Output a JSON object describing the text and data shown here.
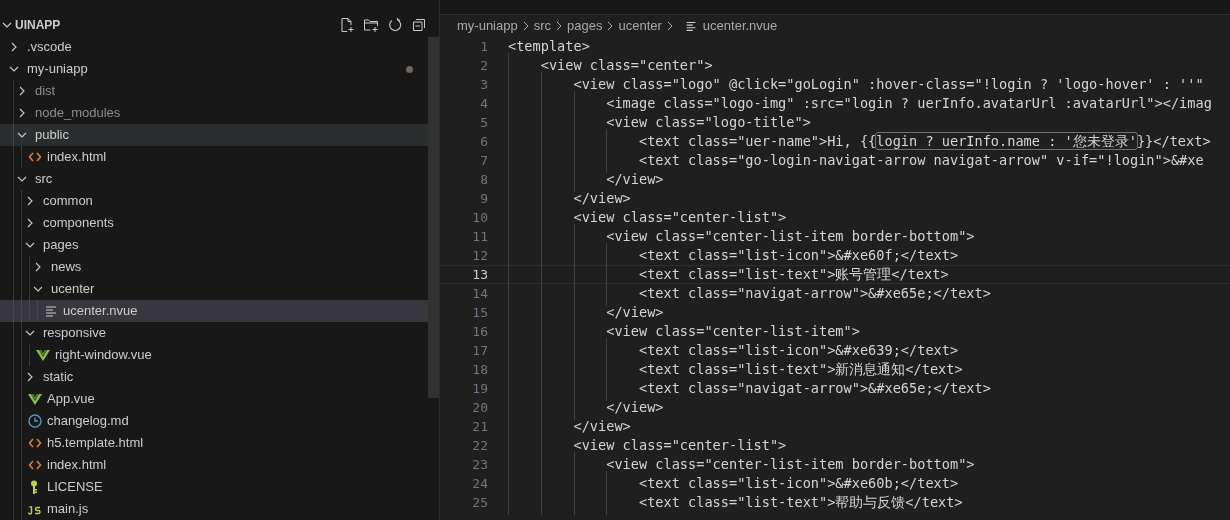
{
  "explorer": {
    "title": "UINAPP",
    "expanded": true,
    "items": [
      {
        "name": ".vscode",
        "kind": "folder",
        "expanded": false,
        "selected": false,
        "hovered": false,
        "dimmed": false,
        "modified": false
      },
      {
        "name": "my-uniapp",
        "kind": "folder",
        "expanded": true,
        "selected": false,
        "hovered": false,
        "dimmed": false,
        "modified": true,
        "children": [
          {
            "name": "dist",
            "kind": "folder",
            "expanded": false,
            "selected": false,
            "hovered": false,
            "dimmed": true,
            "modified": false
          },
          {
            "name": "node_modules",
            "kind": "folder",
            "expanded": false,
            "selected": false,
            "hovered": false,
            "dimmed": true,
            "modified": false
          },
          {
            "name": "public",
            "kind": "folder",
            "expanded": true,
            "selected": false,
            "hovered": true,
            "dimmed": false,
            "modified": false,
            "children": [
              {
                "name": "index.html",
                "kind": "html",
                "selected": false,
                "hovered": false,
                "dimmed": false,
                "modified": false
              }
            ]
          },
          {
            "name": "src",
            "kind": "folder",
            "expanded": true,
            "selected": false,
            "hovered": false,
            "dimmed": false,
            "modified": false,
            "children": [
              {
                "name": "common",
                "kind": "folder",
                "expanded": false,
                "selected": false,
                "hovered": false,
                "dimmed": false,
                "modified": false
              },
              {
                "name": "components",
                "kind": "folder",
                "expanded": false,
                "selected": false,
                "hovered": false,
                "dimmed": false,
                "modified": false
              },
              {
                "name": "pages",
                "kind": "folder",
                "expanded": true,
                "selected": false,
                "hovered": false,
                "dimmed": false,
                "modified": false,
                "children": [
                  {
                    "name": "news",
                    "kind": "folder",
                    "expanded": false,
                    "selected": false,
                    "hovered": false,
                    "dimmed": false,
                    "modified": false
                  },
                  {
                    "name": "ucenter",
                    "kind": "folder",
                    "expanded": true,
                    "selected": false,
                    "hovered": false,
                    "dimmed": false,
                    "modified": false,
                    "children": [
                      {
                        "name": "ucenter.nvue",
                        "kind": "text",
                        "selected": true,
                        "hovered": false,
                        "dimmed": false,
                        "modified": false
                      }
                    ]
                  }
                ]
              },
              {
                "name": "responsive",
                "kind": "folder",
                "expanded": true,
                "selected": false,
                "hovered": false,
                "dimmed": false,
                "modified": false,
                "children": [
                  {
                    "name": "right-window.vue",
                    "kind": "vue",
                    "selected": false,
                    "hovered": false,
                    "dimmed": false,
                    "modified": false
                  }
                ]
              },
              {
                "name": "static",
                "kind": "folder",
                "expanded": false,
                "selected": false,
                "hovered": false,
                "dimmed": false,
                "modified": false
              },
              {
                "name": "App.vue",
                "kind": "vue",
                "selected": false,
                "hovered": false,
                "dimmed": false,
                "modified": false
              },
              {
                "name": "changelog.md",
                "kind": "clock",
                "selected": false,
                "hovered": false,
                "dimmed": false,
                "modified": false
              },
              {
                "name": "h5.template.html",
                "kind": "html",
                "selected": false,
                "hovered": false,
                "dimmed": false,
                "modified": false
              },
              {
                "name": "index.html",
                "kind": "html",
                "selected": false,
                "hovered": false,
                "dimmed": false,
                "modified": false
              },
              {
                "name": "LICENSE",
                "kind": "license",
                "selected": false,
                "hovered": false,
                "dimmed": false,
                "modified": false
              },
              {
                "name": "main.js",
                "kind": "js",
                "selected": false,
                "hovered": false,
                "dimmed": false,
                "modified": false
              }
            ]
          }
        ]
      }
    ]
  },
  "breadcrumb": [
    "my-uniapp",
    "src",
    "pages",
    "ucenter",
    "ucenter.nvue"
  ],
  "code": [
    {
      "number": "1",
      "current": false,
      "text": "<template>"
    },
    {
      "number": "2",
      "current": false,
      "text": "    <view class=\"center\">"
    },
    {
      "number": "3",
      "current": false,
      "text": "        <view class=\"logo\" @click=\"goLogin\" :hover-class=\"!login ? 'logo-hover' : ''\""
    },
    {
      "number": "4",
      "current": false,
      "text": "            <image class=\"logo-img\" :src=\"login ? uerInfo.avatarUrl :avatarUrl\"></imag"
    },
    {
      "number": "5",
      "current": false,
      "text": "            <view class=\"logo-title\">"
    },
    {
      "number": "6",
      "current": false,
      "text": "                <text class=\"uer-name\">Hi, {{",
      "boxed": "login ? uerInfo.name : '您未登录'",
      "after": "}}</text>"
    },
    {
      "number": "7",
      "current": false,
      "text": "                <text class=\"go-login-navigat-arrow navigat-arrow\" v-if=\"!login\">&#xe"
    },
    {
      "number": "8",
      "current": false,
      "text": "            </view>"
    },
    {
      "number": "9",
      "current": false,
      "text": "        </view>"
    },
    {
      "number": "10",
      "current": false,
      "text": "        <view class=\"center-list\">"
    },
    {
      "number": "11",
      "current": false,
      "text": "            <view class=\"center-list-item border-bottom\">"
    },
    {
      "number": "12",
      "current": false,
      "text": "                <text class=\"list-icon\">&#xe60f;</text>"
    },
    {
      "number": "13",
      "current": true,
      "text": "                <text class=\"list-text\">账号管理</text>"
    },
    {
      "number": "14",
      "current": false,
      "text": "                <text class=\"navigat-arrow\">&#xe65e;</text>"
    },
    {
      "number": "15",
      "current": false,
      "text": "            </view>"
    },
    {
      "number": "16",
      "current": false,
      "text": "            <view class=\"center-list-item\">"
    },
    {
      "number": "17",
      "current": false,
      "text": "                <text class=\"list-icon\">&#xe639;</text>"
    },
    {
      "number": "18",
      "current": false,
      "text": "                <text class=\"list-text\">新消息通知</text>"
    },
    {
      "number": "19",
      "current": false,
      "text": "                <text class=\"navigat-arrow\">&#xe65e;</text>"
    },
    {
      "number": "20",
      "current": false,
      "text": "            </view>"
    },
    {
      "number": "21",
      "current": false,
      "text": "        </view>"
    },
    {
      "number": "22",
      "current": false,
      "text": "        <view class=\"center-list\">"
    },
    {
      "number": "23",
      "current": false,
      "text": "            <view class=\"center-list-item border-bottom\">"
    },
    {
      "number": "24",
      "current": false,
      "text": "                <text class=\"list-icon\">&#xe60b;</text>"
    },
    {
      "number": "25",
      "current": false,
      "text": "                <text class=\"list-text\">帮助与反馈</text>"
    }
  ]
}
